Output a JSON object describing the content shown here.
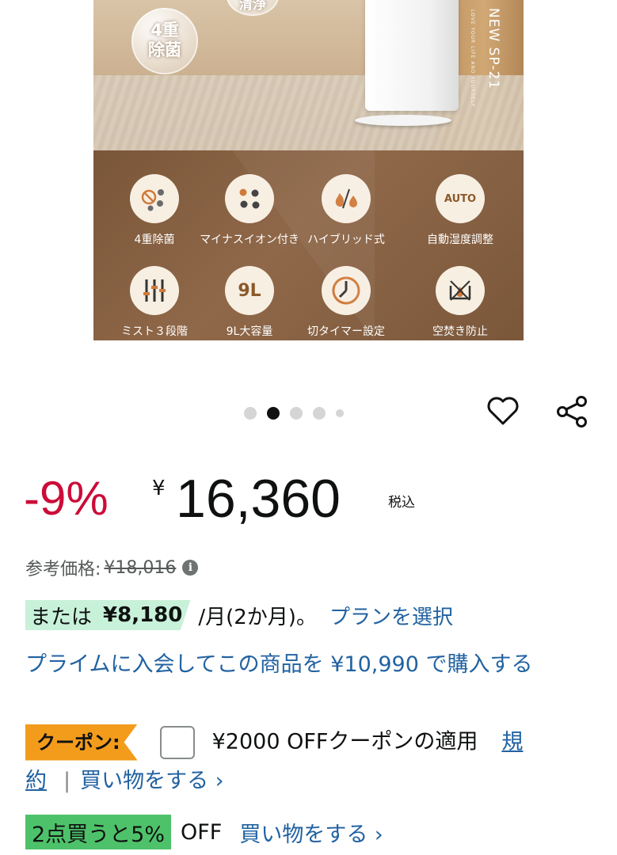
{
  "product_image": {
    "badges": [
      "4重",
      "除菌"
    ],
    "badge_top": "清浄",
    "model": "NEW SP-21",
    "model_sub": "LOVE YOUR LIFE AND YOURSELF",
    "features": [
      {
        "icon": "⊘",
        "label": "4重除菌"
      },
      {
        "icon": "⁘",
        "label": "マイナスイオン付き"
      },
      {
        "icon": "🔥",
        "label": "ハイブリッド式"
      },
      {
        "icon": "AUTO",
        "label": "自動湿度調整"
      },
      {
        "icon": "⫼",
        "label": "ミスト３段階"
      },
      {
        "icon": "9L",
        "label": "9L大容量"
      },
      {
        "icon": "◔",
        "label": "切タイマー設定"
      },
      {
        "icon": "⌧",
        "label": "空焚き防止"
      }
    ]
  },
  "carousel": {
    "dots": 5,
    "active_index": 1
  },
  "actions": {
    "favorite_icon": "heart-icon",
    "share_icon": "share-icon"
  },
  "price": {
    "discount": "-9%",
    "currency_symbol": "¥",
    "amount": "16,360",
    "tax_label": "税込",
    "reference_label": "参考価格:",
    "reference_price": "¥18,016"
  },
  "installment": {
    "prefix": "または",
    "amount": "¥8,180",
    "term": "/月(2か月)。",
    "plan_link": "プランを選択"
  },
  "prime_offer": {
    "text": "プライムに入会してこの商品を ¥10,990 で購入する"
  },
  "coupon": {
    "badge": "クーポン:",
    "text": "¥2000 OFFクーポンの適用",
    "terms_link": "規約",
    "separator": "|",
    "shop_link": "買い物をする ›"
  },
  "bulk_offer": {
    "badge": "2点買うと5%",
    "off_text": "OFF",
    "shop_link": "買い物をする ›"
  },
  "colors": {
    "discount": "#cc0c39",
    "link": "#2162a1",
    "coupon_badge": "#f39c1c",
    "bulk_badge": "#4ec26a",
    "installment_bg": "#c8f1d9"
  }
}
